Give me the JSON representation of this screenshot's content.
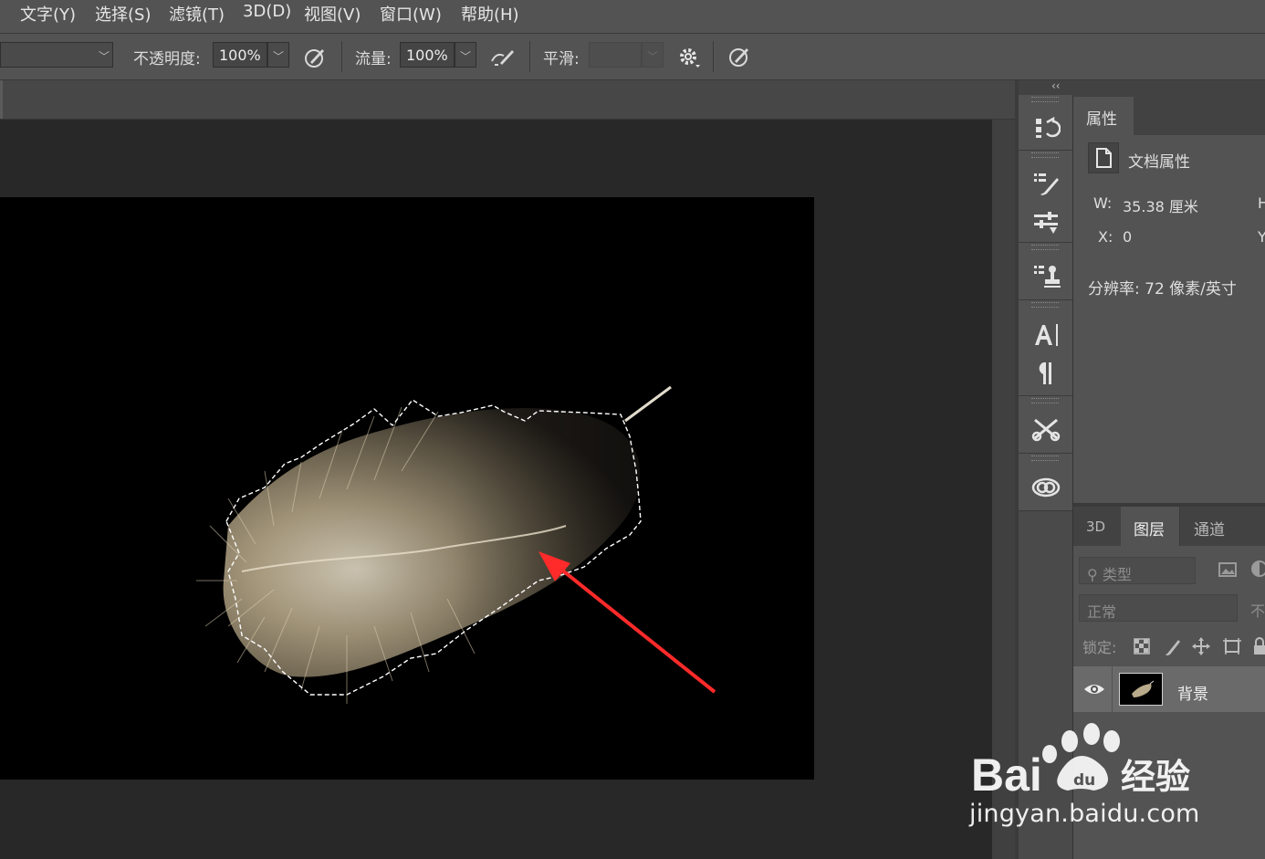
{
  "menu": {
    "items": [
      "文字(Y)",
      "选择(S)",
      "滤镜(T)",
      "3D(D)",
      "视图(V)",
      "窗口(W)",
      "帮助(H)"
    ]
  },
  "options": {
    "opacity_label": "不透明度:",
    "opacity_value": "100%",
    "flow_label": "流量:",
    "flow_value": "100%",
    "smoothing_label": "平滑:",
    "smoothing_value": ""
  },
  "properties": {
    "tab_label": "属性",
    "section_title": "文档属性",
    "width_label": "W:",
    "width_value": "35.38 厘米",
    "height_label": "H",
    "x_label": "X:",
    "x_value": "0",
    "y_label": "Y",
    "resolution": "分辨率: 72 像素/英寸"
  },
  "layers": {
    "tabs": [
      "3D",
      "图层",
      "通道"
    ],
    "active_tab": "图层",
    "filter_placeholder": "类型",
    "blend_mode": "正常",
    "opacity_abbrev": "不",
    "lock_label": "锁定:",
    "layer_name": "背景"
  },
  "watermark": {
    "brand": "Bai",
    "brand_suffix": "经验",
    "url": "jingyan.baidu.com"
  },
  "colors": {
    "accent_arrow": "#ff2a2a",
    "panel_bg": "#535353",
    "canvas_bg": "#000000"
  }
}
